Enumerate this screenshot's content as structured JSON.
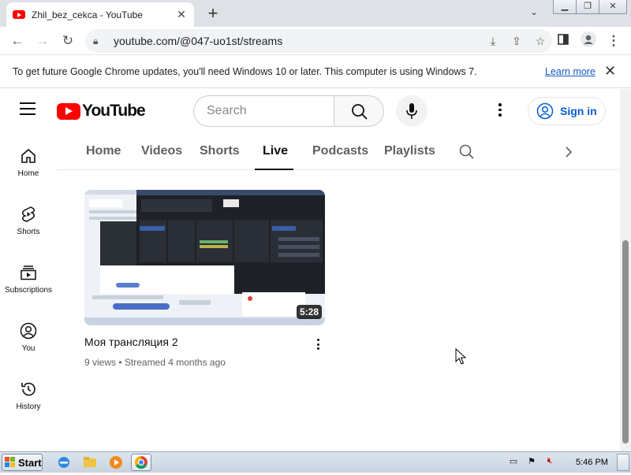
{
  "browser": {
    "tab_title": "Zhil_bez_cekca - YouTube",
    "url": "youtube.com/@047-uo1st/streams",
    "infobar": {
      "message": "To get future Google Chrome updates, you'll need Windows 10 or later. This computer is using Windows 7.",
      "learn_more": "Learn more"
    }
  },
  "youtube": {
    "logo_text": "YouTube",
    "search_placeholder": "Search",
    "sign_in": "Sign in",
    "sidebar": [
      {
        "label": "Home",
        "icon": "home-icon"
      },
      {
        "label": "Shorts",
        "icon": "shorts-icon"
      },
      {
        "label": "Subscriptions",
        "icon": "subscriptions-icon"
      },
      {
        "label": "You",
        "icon": "you-icon"
      },
      {
        "label": "History",
        "icon": "history-icon"
      }
    ],
    "channel_tabs": [
      "Home",
      "Videos",
      "Shorts",
      "Live",
      "Podcasts",
      "Playlists"
    ],
    "active_tab": "Live",
    "video": {
      "title": "Моя трансляция 2",
      "duration": "5:28",
      "views": "9 views",
      "streamed": "Streamed 4 months ago",
      "meta": "9 views • Streamed 4 months ago"
    }
  },
  "taskbar": {
    "start_label": "Start",
    "clock": "5:46 PM"
  },
  "colors": {
    "youtube_red": "#ff0000",
    "link_blue": "#065fd4",
    "chrome_tabbar": "#dee1e6"
  }
}
